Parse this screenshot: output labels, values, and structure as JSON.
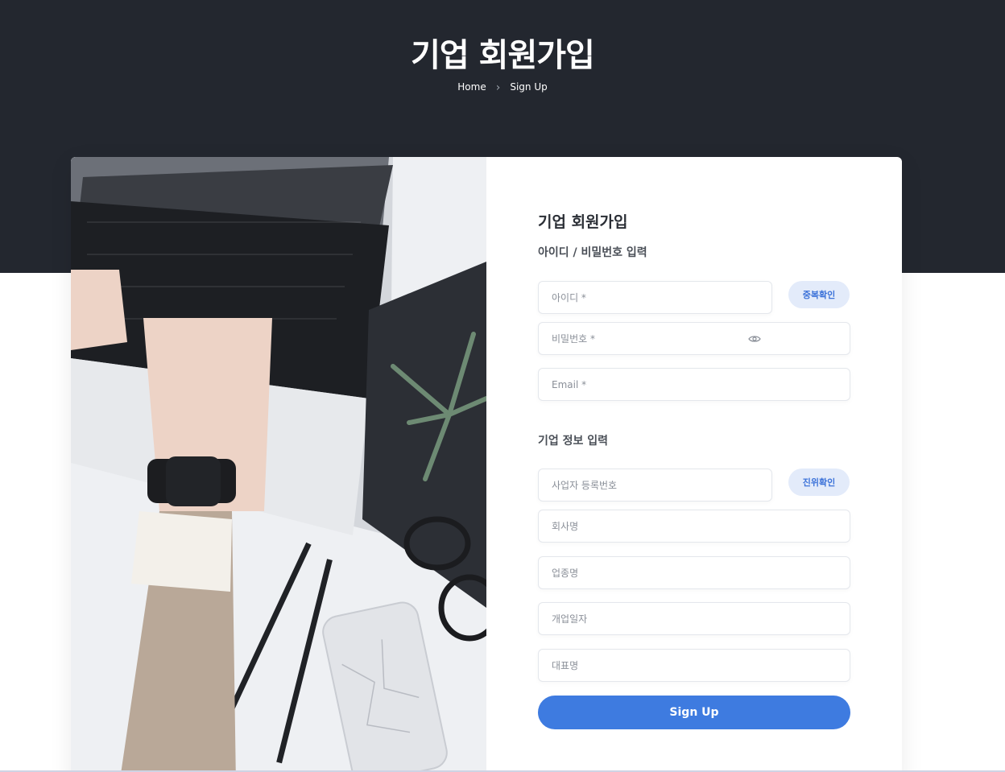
{
  "hero": {
    "title": "기업 회원가입"
  },
  "breadcrumb": {
    "home": "Home",
    "separator": "›",
    "current": "Sign Up"
  },
  "form": {
    "title": "기업 회원가입",
    "section_account": "아이디 / 비밀번호 입력",
    "section_company": "기업 정보 입력",
    "fields": {
      "id_placeholder": "아이디 *",
      "password_placeholder": "비밀번호 *",
      "email_placeholder": "Email *",
      "biz_number_placeholder": "사업자 등록번호",
      "company_name_placeholder": "회사명",
      "industry_placeholder": "업종명",
      "founding_date_placeholder": "개업일자",
      "ceo_placeholder": "대표명"
    },
    "buttons": {
      "check_duplicate": "중복확인",
      "verify": "진위확인",
      "submit": "Sign Up"
    }
  },
  "icons": {
    "password_toggle": "eye-icon"
  },
  "colors": {
    "hero_bg": "#23272f",
    "accent": "#3e7be0",
    "pill_bg": "#e3ebfa",
    "pill_text": "#3d73d9"
  }
}
